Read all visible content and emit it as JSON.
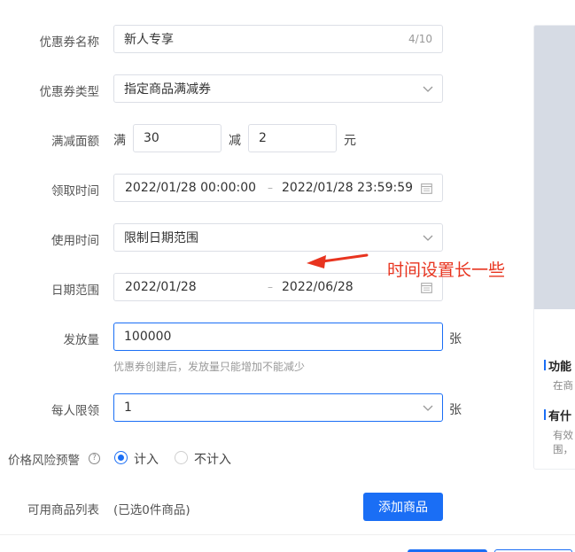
{
  "form": {
    "name": {
      "label": "优惠券名称",
      "value": "新人专享",
      "counter": "4/10"
    },
    "type": {
      "label": "优惠券类型",
      "value": "指定商品满减券"
    },
    "discount": {
      "label": "满减面额",
      "prefix": "满",
      "threshold": "30",
      "middle": "减",
      "amount": "2",
      "suffix": "元"
    },
    "claim_time": {
      "label": "领取时间",
      "start": "2022/01/28 00:00:00",
      "end": "2022/01/28 23:59:59",
      "sep": "–"
    },
    "use_time": {
      "label": "使用时间",
      "value": "限制日期范围"
    },
    "date_range": {
      "label": "日期范围",
      "start": "2022/01/28",
      "end": "2022/06/28",
      "sep": "–"
    },
    "quantity": {
      "label": "发放量",
      "value": "100000",
      "unit": "张",
      "hint": "优惠券创建后，发放量只能增加不能减少"
    },
    "per_person": {
      "label": "每人限领",
      "value": "1",
      "unit": "张"
    },
    "price_risk": {
      "label": "价格风险预警",
      "help": "?",
      "options": [
        "计入",
        "不计入"
      ],
      "selected": 0
    },
    "products": {
      "label": "可用商品列表",
      "summary": "(已选0件商品)",
      "add_button": "添加商品"
    }
  },
  "side_panel": {
    "section1_title": "功能",
    "section1_text": "在商",
    "section2_title": "有什",
    "section2_text_line1": "有效",
    "section2_text_line2": "围，"
  },
  "annotation": {
    "text": "时间设置长一些",
    "color": "#e8341f"
  },
  "colors": {
    "primary": "#1a6ef5",
    "border": "#dcdfe6",
    "label": "#555555"
  }
}
